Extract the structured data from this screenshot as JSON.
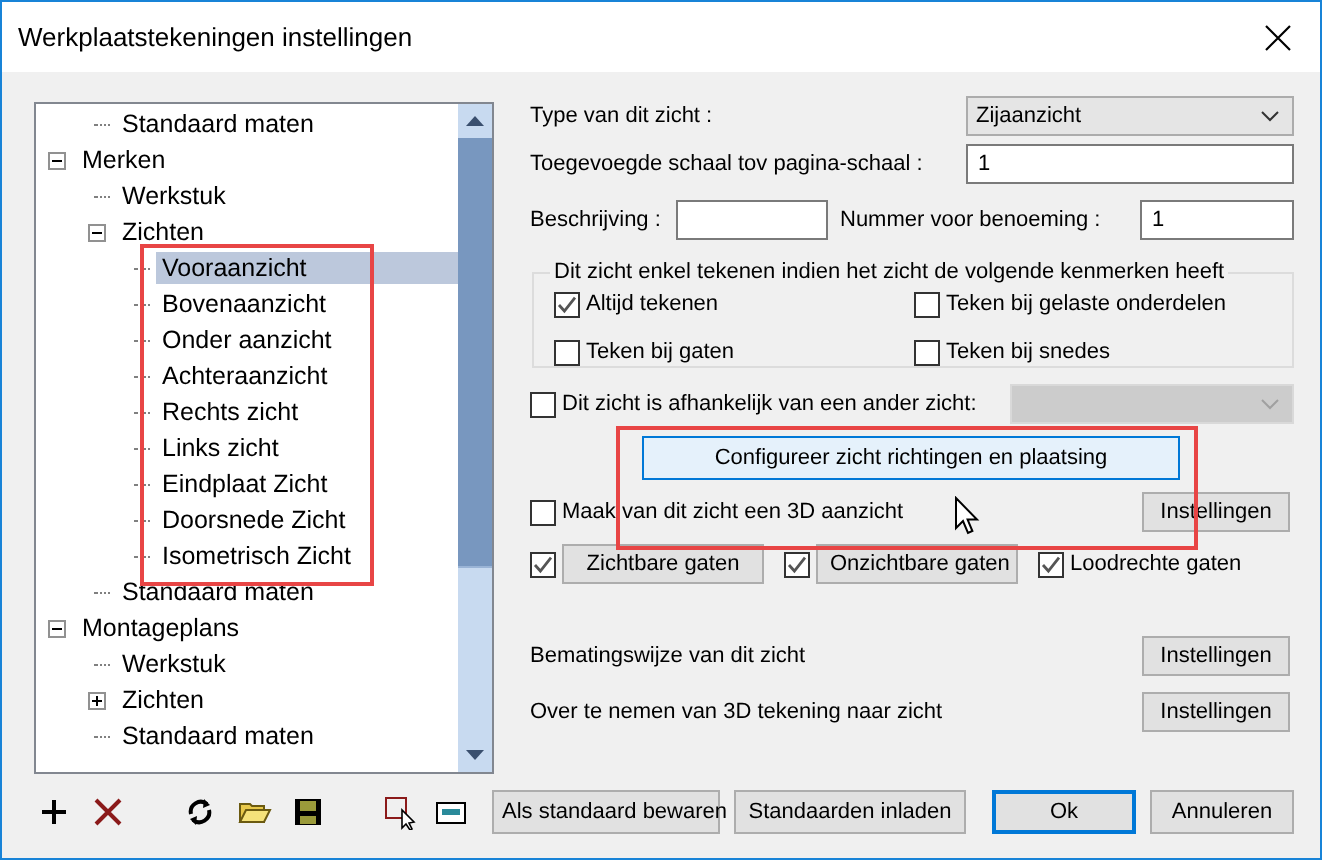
{
  "window": {
    "title": "Werkplaatstekeningen instellingen"
  },
  "tree": {
    "continued_items": [
      {
        "label": "Standaard maten",
        "selected": false
      }
    ],
    "items": [
      {
        "label": "Merken",
        "expanded": true,
        "selected": false,
        "children": [
          {
            "label": "Werkstuk",
            "selected": false
          },
          {
            "label": "Zichten",
            "expanded": true,
            "selected": false,
            "children": [
              {
                "label": "Vooraanzicht",
                "selected": true
              },
              {
                "label": "Bovenaanzicht",
                "selected": false
              },
              {
                "label": "Onder aanzicht",
                "selected": false
              },
              {
                "label": "Achteraanzicht",
                "selected": false
              },
              {
                "label": "Rechts zicht",
                "selected": false
              },
              {
                "label": "Links zicht",
                "selected": false
              },
              {
                "label": "Eindplaat Zicht",
                "selected": false
              },
              {
                "label": "Doorsnede Zicht",
                "selected": false
              },
              {
                "label": "Isometrisch Zicht",
                "selected": false
              }
            ]
          },
          {
            "label": "Standaard maten",
            "selected": false
          }
        ]
      },
      {
        "label": "Montageplans",
        "expanded": true,
        "selected": false,
        "children": [
          {
            "label": "Werkstuk",
            "selected": false
          },
          {
            "label": "Zichten",
            "expanded": false,
            "selected": false
          },
          {
            "label": "Standaard maten",
            "selected": false
          }
        ]
      }
    ]
  },
  "view_type": {
    "label": "Type van dit zicht :",
    "value": "Zijaanzicht"
  },
  "scale": {
    "label": "Toegevoegde schaal tov pagina-schaal :",
    "value": "1"
  },
  "description": {
    "label": "Beschrijving :"
  },
  "number": {
    "label": "Nummer voor benoeming :",
    "value": "1"
  },
  "criteria": {
    "title": "Dit zicht enkel tekenen indien het zicht de volgende kenmerken heeft",
    "options": [
      {
        "label": "Altijd tekenen",
        "checked": true
      },
      {
        "label": "Teken bij gelaste onderdelen",
        "checked": false
      },
      {
        "label": "Teken bij gaten",
        "checked": false
      },
      {
        "label": "Teken bij snedes",
        "checked": false
      }
    ]
  },
  "dependent": {
    "label": "Dit zicht is afhankelijk van een ander zicht:",
    "checked": false,
    "dropdown_disabled": true
  },
  "configure_button": {
    "label": "Configureer zicht richtingen en plaatsing",
    "hovered": true
  },
  "make_3d": {
    "label": "Maak van dit zicht een 3D aanzicht",
    "checked": false,
    "button": "Instellingen"
  },
  "holes": [
    {
      "kind": "button",
      "label": "Zichtbare gaten",
      "checked": true
    },
    {
      "kind": "button",
      "label": "Onzichtbare gaten",
      "checked": true
    },
    {
      "kind": "label",
      "label": "Loodrechte gaten",
      "checked": true
    }
  ],
  "settings_rows": [
    {
      "label": "Bematingswijze van dit zicht",
      "button": "Instellingen"
    },
    {
      "label": "Over te nemen van 3D tekening naar zicht",
      "button": "Instellingen"
    }
  ],
  "footer_buttons": [
    {
      "label": "Als standaard bewaren",
      "default": false
    },
    {
      "label": "Standaarden inladen",
      "default": false
    },
    {
      "label": "Ok",
      "default": true
    },
    {
      "label": "Annuleren",
      "default": false
    }
  ]
}
